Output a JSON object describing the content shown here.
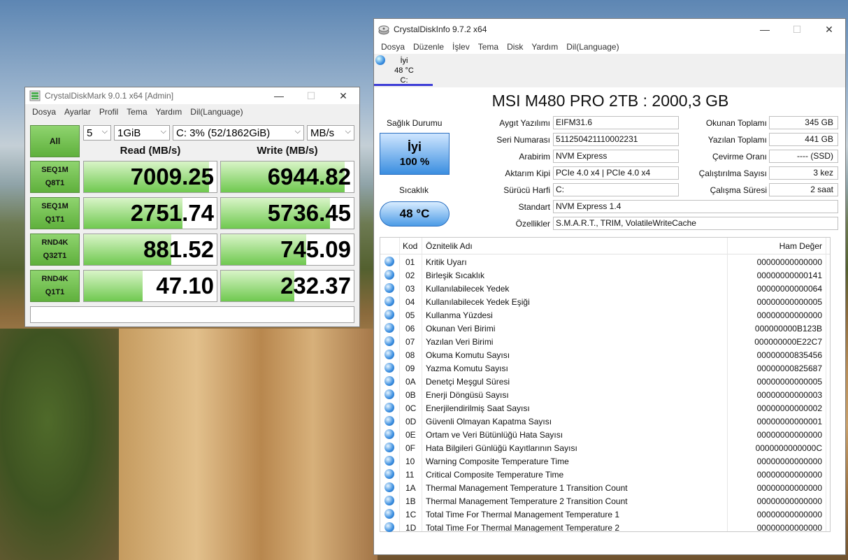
{
  "cdm": {
    "title": "CrystalDiskMark 9.0.1 x64 [Admin]",
    "menu": [
      "Dosya",
      "Ayarlar",
      "Profil",
      "Tema",
      "Yardım",
      "Dil(Language)"
    ],
    "all_label": "All",
    "count": "5",
    "size": "1GiB",
    "drive": "C: 3% (52/1862GiB)",
    "unit": "MB/s",
    "read_header": "Read (MB/s)",
    "write_header": "Write (MB/s)",
    "tests": [
      {
        "line1": "SEQ1M",
        "line2": "Q8T1",
        "read": "7009.25",
        "write": "6944.82",
        "read_fill": 0.94,
        "write_fill": 0.93
      },
      {
        "line1": "SEQ1M",
        "line2": "Q1T1",
        "read": "2751.74",
        "write": "5736.45",
        "read_fill": 0.74,
        "write_fill": 0.82
      },
      {
        "line1": "RND4K",
        "line2": "Q32T1",
        "read": "881.52",
        "write": "745.09",
        "read_fill": 0.66,
        "write_fill": 0.64
      },
      {
        "line1": "RND4K",
        "line2": "Q1T1",
        "read": "47.10",
        "write": "232.37",
        "read_fill": 0.44,
        "write_fill": 0.55
      }
    ]
  },
  "cdi": {
    "title": "CrystalDiskInfo 9.7.2 x64",
    "menu": [
      "Dosya",
      "Düzenle",
      "İşlev",
      "Tema",
      "Disk",
      "Yardım",
      "Dil(Language)"
    ],
    "tab": {
      "status": "İyi",
      "temp": "48 °C",
      "drive": "C:"
    },
    "model": "MSI M480 PRO 2TB : 2000,3 GB",
    "health_label": "Sağlık Durumu",
    "health_status": "İyi",
    "health_percent": "100 %",
    "temp_label": "Sıcaklık",
    "temp_value": "48 °C",
    "fields_left": [
      {
        "label": "Aygıt Yazılımı",
        "value": "EIFM31.6"
      },
      {
        "label": "Seri Numarası",
        "value": "511250421110002231"
      },
      {
        "label": "Arabirim",
        "value": "NVM Express"
      },
      {
        "label": "Aktarım Kipi",
        "value": "PCIe 4.0 x4 | PCIe 4.0 x4"
      },
      {
        "label": "Sürücü Harfi",
        "value": "C:"
      }
    ],
    "fields_right": [
      {
        "label": "Okunan Toplamı",
        "value": "345 GB"
      },
      {
        "label": "Yazılan Toplamı",
        "value": "441 GB"
      },
      {
        "label": "Çevirme Oranı",
        "value": "---- (SSD)"
      },
      {
        "label": "Çalıştırılma Sayısı",
        "value": "3 kez"
      },
      {
        "label": "Çalışma Süresi",
        "value": "2 saat"
      }
    ],
    "standard_label": "Standart",
    "standard_value": "NVM Express 1.4",
    "features_label": "Özellikler",
    "features_value": "S.M.A.R.T., TRIM, VolatileWriteCache",
    "smart_headers": {
      "code": "Kod",
      "name": "Öznitelik Adı",
      "raw": "Ham Değer"
    },
    "smart_rows": [
      {
        "code": "01",
        "name": "Kritik Uyarı",
        "raw": "00000000000000"
      },
      {
        "code": "02",
        "name": "Birleşik Sıcaklık",
        "raw": "00000000000141"
      },
      {
        "code": "03",
        "name": "Kullanılabilecek Yedek",
        "raw": "00000000000064"
      },
      {
        "code": "04",
        "name": "Kullanılabilecek Yedek Eşiği",
        "raw": "00000000000005"
      },
      {
        "code": "05",
        "name": "Kullanma Yüzdesi",
        "raw": "00000000000000"
      },
      {
        "code": "06",
        "name": "Okunan Veri Birimi",
        "raw": "000000000B123B"
      },
      {
        "code": "07",
        "name": "Yazılan Veri Birimi",
        "raw": "000000000E22C7"
      },
      {
        "code": "08",
        "name": "Okuma Komutu Sayısı",
        "raw": "00000000835456"
      },
      {
        "code": "09",
        "name": "Yazma Komutu Sayısı",
        "raw": "00000000825687"
      },
      {
        "code": "0A",
        "name": "Denetçi Meşgul Süresi",
        "raw": "00000000000005"
      },
      {
        "code": "0B",
        "name": "Enerji Döngüsü Sayısı",
        "raw": "00000000000003"
      },
      {
        "code": "0C",
        "name": "Enerjilendirilmiş Saat Sayısı",
        "raw": "00000000000002"
      },
      {
        "code": "0D",
        "name": "Güvenli Olmayan Kapatma Sayısı",
        "raw": "00000000000001"
      },
      {
        "code": "0E",
        "name": "Ortam ve Veri Bütünlüğü Hata Sayısı",
        "raw": "00000000000000"
      },
      {
        "code": "0F",
        "name": "Hata Bilgileri Günlüğü Kayıtlarının Sayısı",
        "raw": "0000000000000C"
      },
      {
        "code": "10",
        "name": "Warning Composite Temperature Time",
        "raw": "00000000000000"
      },
      {
        "code": "11",
        "name": "Critical Composite Temperature Time",
        "raw": "00000000000000"
      },
      {
        "code": "1A",
        "name": "Thermal Management Temperature 1 Transition Count",
        "raw": "00000000000000"
      },
      {
        "code": "1B",
        "name": "Thermal Management Temperature 2 Transition Count",
        "raw": "00000000000000"
      },
      {
        "code": "1C",
        "name": "Total Time For Thermal Management Temperature 1",
        "raw": "00000000000000"
      },
      {
        "code": "1D",
        "name": "Total Time For Thermal Management Temperature 2",
        "raw": "00000000000000"
      }
    ]
  }
}
